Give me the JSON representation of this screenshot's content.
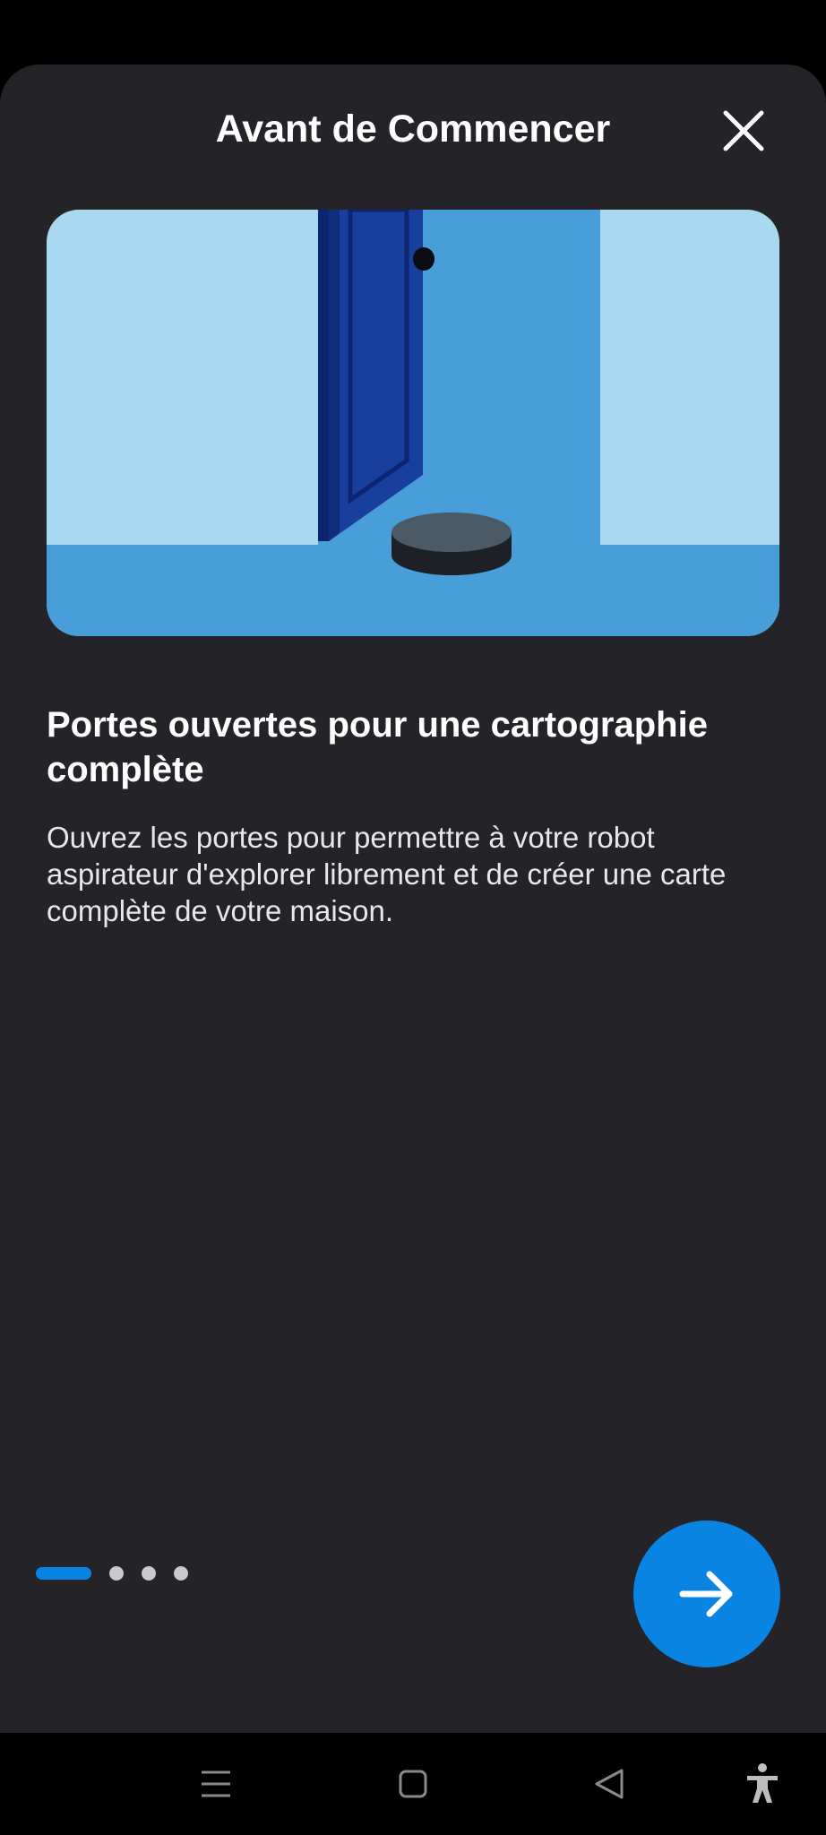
{
  "dialog": {
    "title": "Avant de Commencer",
    "close_icon": "close-icon"
  },
  "slide": {
    "illustration": "open-door-robot-vacuum-illustration",
    "heading": "Portes ouvertes pour une cartographie complète",
    "body": "Ouvrez les portes pour permettre à votre robot aspirateur d'explorer librement et de créer une carte complète de votre maison."
  },
  "pager": {
    "total": 4,
    "current": 1
  },
  "next_button": {
    "icon": "arrow-right-icon"
  },
  "navbar": {
    "icons": [
      "menu-icon",
      "home-icon",
      "back-icon",
      "accessibility-icon"
    ]
  },
  "colors": {
    "background": "#232328",
    "accent": "#0a84e3",
    "illustration_wall": "#a9d8f1",
    "illustration_floor": "#489ed9",
    "door": "#183f9c"
  }
}
